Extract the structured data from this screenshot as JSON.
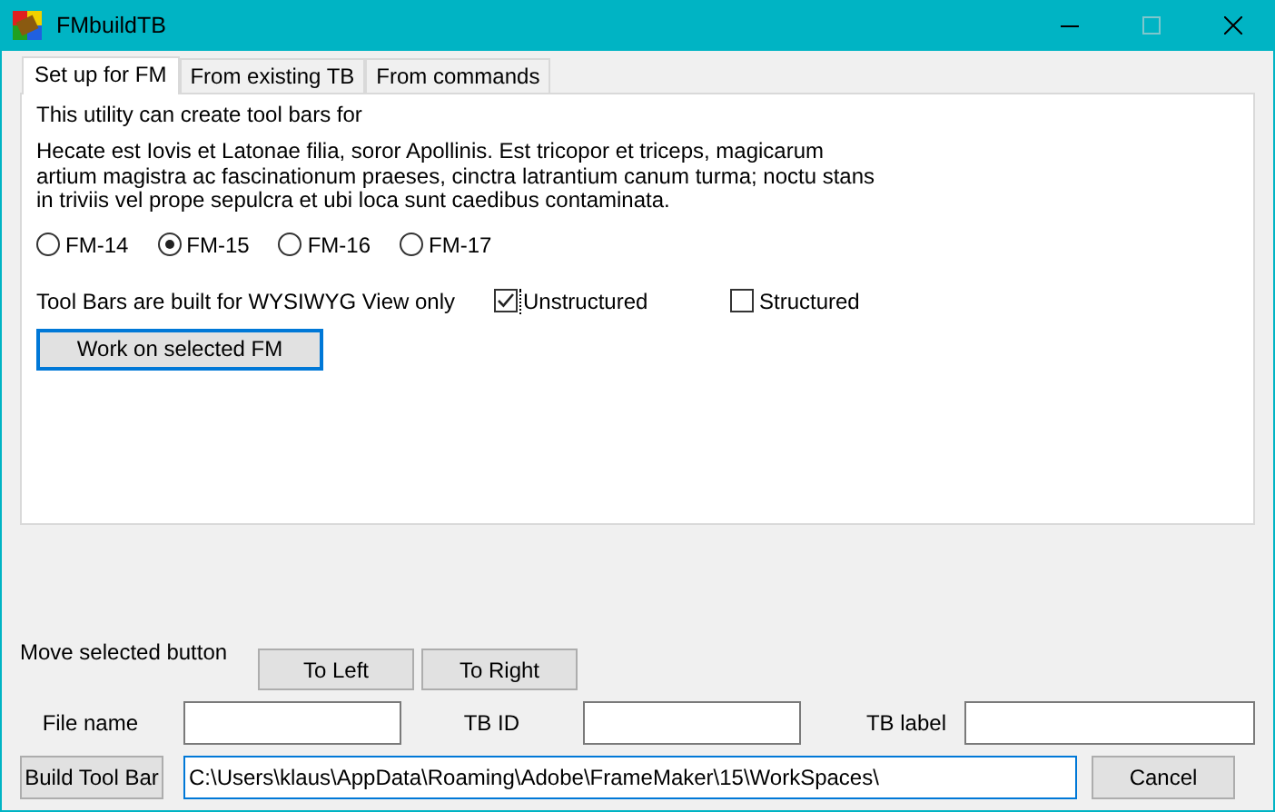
{
  "window": {
    "title": "FMbuildTB"
  },
  "tabs": [
    {
      "label": "Set up for FM",
      "selected": true
    },
    {
      "label": "From existing TB",
      "selected": false
    },
    {
      "label": "From commands",
      "selected": false
    }
  ],
  "panel": {
    "intro": "This utility can create tool bars for",
    "description": "Hecate est Iovis et Latonae filia, soror Apollinis. Est tricopor et triceps, magicarum artium magistra ac fascinationum praeses, cinctra latrantium canum turma; noctu stans in triviis vel prope sepulcra et ubi loca sunt caedibus contaminata.",
    "versions": [
      {
        "label": "FM-14",
        "selected": false
      },
      {
        "label": "FM-15",
        "selected": true
      },
      {
        "label": "FM-16",
        "selected": false
      },
      {
        "label": "FM-17",
        "selected": false
      }
    ],
    "view_note": "Tool Bars are built for WYSIWYG View only",
    "modes": [
      {
        "label": "Unstructured",
        "checked": true
      },
      {
        "label": "Structured",
        "checked": false
      }
    ],
    "work_button": "Work on selected FM"
  },
  "move": {
    "label": "Move selected button",
    "buttons": [
      "To Left",
      "To Right"
    ]
  },
  "fields": [
    {
      "label": "File name"
    },
    {
      "label": "TB ID"
    },
    {
      "label": "TB label"
    }
  ],
  "build_button": "Build Tool Bar",
  "path": {
    "value": "C:\\Users\\klaus\\AppData\\Roaming\\Adobe\\FrameMaker\\15\\WorkSpaces\\"
  },
  "cancel_button": "Cancel"
}
